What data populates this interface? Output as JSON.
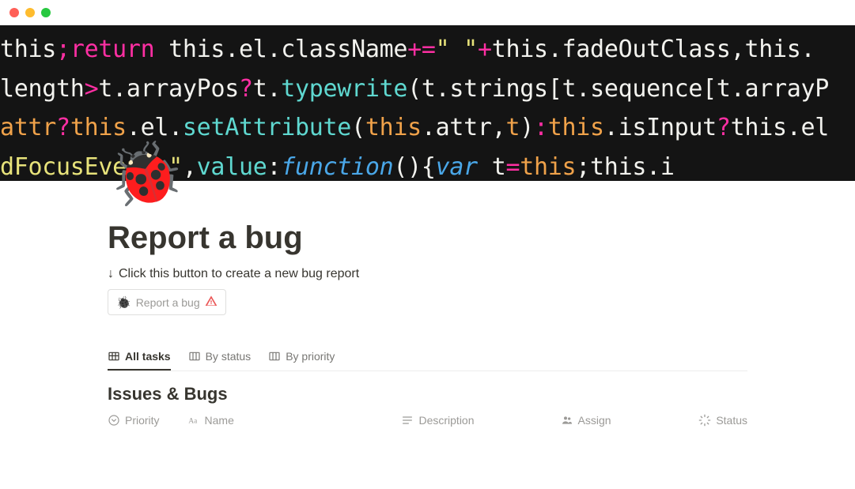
{
  "page": {
    "icon_emoji": "🐞",
    "title": "Report a bug",
    "subtitle": "Click this button to create a new bug report",
    "button_label": "Report a bug"
  },
  "tabs": [
    {
      "label": "All tasks",
      "active": true
    },
    {
      "label": "By status",
      "active": false
    },
    {
      "label": "By priority",
      "active": false
    }
  ],
  "database": {
    "title": "Issues & Bugs",
    "columns": [
      {
        "label": "Priority"
      },
      {
        "label": "Name"
      },
      {
        "label": "Description"
      },
      {
        "label": "Assign"
      },
      {
        "label": "Status"
      }
    ]
  },
  "cover_code": {
    "line1": [
      {
        "t": "this",
        "c": "white"
      },
      {
        "t": ";",
        "c": "pink"
      },
      {
        "t": "return",
        "c": "pink"
      },
      {
        "t": " this",
        "c": "white"
      },
      {
        "t": ".",
        "c": "white"
      },
      {
        "t": "el",
        "c": "white"
      },
      {
        "t": ".",
        "c": "white"
      },
      {
        "t": "className",
        "c": "white"
      },
      {
        "t": "+=",
        "c": "pink"
      },
      {
        "t": "\" \"",
        "c": "yellow"
      },
      {
        "t": "+",
        "c": "pink"
      },
      {
        "t": "this",
        "c": "white"
      },
      {
        "t": ".",
        "c": "white"
      },
      {
        "t": "fadeOutClass",
        "c": "white"
      },
      {
        "t": ",",
        "c": "white"
      },
      {
        "t": "this.",
        "c": "white"
      }
    ],
    "line2": [
      {
        "t": "length",
        "c": "white"
      },
      {
        "t": ">",
        "c": "pink"
      },
      {
        "t": "t",
        "c": "white"
      },
      {
        "t": ".",
        "c": "white"
      },
      {
        "t": "arrayPos",
        "c": "white"
      },
      {
        "t": "?",
        "c": "pink"
      },
      {
        "t": "t",
        "c": "white"
      },
      {
        "t": ".",
        "c": "white"
      },
      {
        "t": "typewrite",
        "c": "teal"
      },
      {
        "t": "(",
        "c": "white"
      },
      {
        "t": "t",
        "c": "white"
      },
      {
        "t": ".",
        "c": "white"
      },
      {
        "t": "strings",
        "c": "white"
      },
      {
        "t": "[",
        "c": "white"
      },
      {
        "t": "t",
        "c": "white"
      },
      {
        "t": ".",
        "c": "white"
      },
      {
        "t": "sequence",
        "c": "white"
      },
      {
        "t": "[",
        "c": "white"
      },
      {
        "t": "t",
        "c": "white"
      },
      {
        "t": ".",
        "c": "white"
      },
      {
        "t": "arrayP",
        "c": "white"
      }
    ],
    "line3": [
      {
        "t": "attr",
        "c": "orange"
      },
      {
        "t": "?",
        "c": "pink"
      },
      {
        "t": "this",
        "c": "orange"
      },
      {
        "t": ".",
        "c": "white"
      },
      {
        "t": "el",
        "c": "white"
      },
      {
        "t": ".",
        "c": "white"
      },
      {
        "t": "setAttribute",
        "c": "teal"
      },
      {
        "t": "(",
        "c": "white"
      },
      {
        "t": "this",
        "c": "orange"
      },
      {
        "t": ".",
        "c": "white"
      },
      {
        "t": "attr",
        "c": "white"
      },
      {
        "t": ",",
        "c": "white"
      },
      {
        "t": "t",
        "c": "orange"
      },
      {
        "t": ")",
        "c": "white"
      },
      {
        "t": ":",
        "c": "pink"
      },
      {
        "t": "this",
        "c": "orange"
      },
      {
        "t": ".",
        "c": "white"
      },
      {
        "t": "isInput",
        "c": "white"
      },
      {
        "t": "?",
        "c": "pink"
      },
      {
        "t": "this.el",
        "c": "white"
      }
    ],
    "line4": [
      {
        "t": "      dFocusEvents\"",
        "c": "yellow"
      },
      {
        "t": ",",
        "c": "white"
      },
      {
        "t": "value",
        "c": "teal"
      },
      {
        "t": ":",
        "c": "white"
      },
      {
        "t": "function",
        "c": "blue"
      },
      {
        "t": "()",
        "c": "white"
      },
      {
        "t": "{",
        "c": "white"
      },
      {
        "t": "var",
        "c": "blue"
      },
      {
        "t": " t",
        "c": "white"
      },
      {
        "t": "=",
        "c": "pink"
      },
      {
        "t": "this",
        "c": "orange"
      },
      {
        "t": ";",
        "c": "white"
      },
      {
        "t": "this.i",
        "c": "white"
      }
    ]
  }
}
